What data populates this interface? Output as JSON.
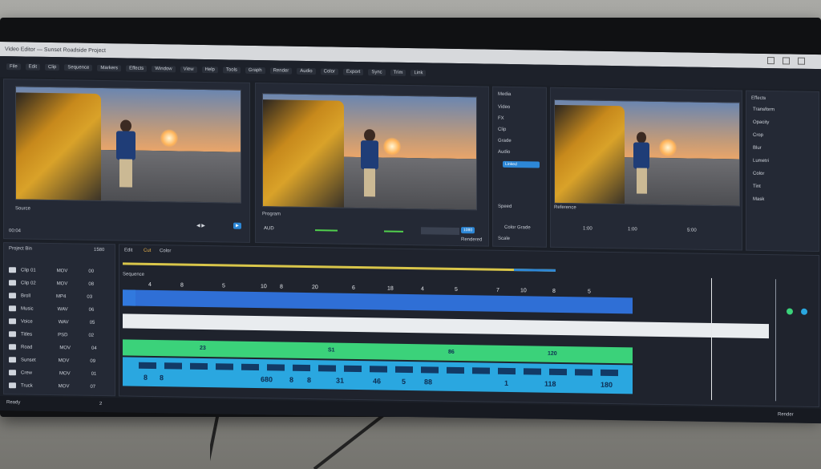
{
  "window": {
    "title": "Video Editor — Sunset Roadside Project"
  },
  "menu": [
    "File",
    "Edit",
    "Clip",
    "Sequence",
    "Markers",
    "Effects",
    "Window",
    "View",
    "Help",
    "Tools",
    "Graph",
    "Render",
    "Audio",
    "Color",
    "Export",
    "Sync",
    "Trim",
    "Link"
  ],
  "monitors": {
    "source": {
      "label": "Source",
      "timecode": "00:04"
    },
    "program": {
      "label": "Program",
      "audio": "AUD",
      "timecode": "1080",
      "right": "Rendered"
    },
    "reference": {
      "label": "Reference",
      "meta": "Color Grade",
      "tc1": "1:00",
      "tc2": "1:00",
      "tc3": "5:00"
    }
  },
  "inspector": {
    "title": "Media",
    "items": [
      "Video",
      "FX",
      "Clip",
      "Grade",
      "Audio"
    ],
    "active": "Linked",
    "footer": "Speed",
    "footer2": "Scale"
  },
  "effects_panel": {
    "title": "Effects",
    "items": [
      "Transform",
      "Opacity",
      "Crop",
      "Blur",
      "Lumetri",
      "Color",
      "Tint",
      "Mask"
    ]
  },
  "bins": {
    "title": "Project Bin",
    "count": "1580",
    "rows": [
      {
        "name": "Clip 01",
        "kind": "MOV",
        "val": "00"
      },
      {
        "name": "Clip 02",
        "kind": "MOV",
        "val": "08"
      },
      {
        "name": "Broll",
        "kind": "MP4",
        "val": "03"
      },
      {
        "name": "Music",
        "kind": "WAV",
        "val": "06"
      },
      {
        "name": "Voice",
        "kind": "WAV",
        "val": "05"
      },
      {
        "name": "Titles",
        "kind": "PSD",
        "val": "02"
      },
      {
        "name": "Road",
        "kind": "MOV",
        "val": "04"
      },
      {
        "name": "Sunset",
        "kind": "MOV",
        "val": "09"
      },
      {
        "name": "Crew",
        "kind": "MOV",
        "val": "01"
      },
      {
        "name": "Truck",
        "kind": "MOV",
        "val": "07"
      }
    ]
  },
  "timeline": {
    "tabs": [
      "Edit",
      "Cut",
      "Color"
    ],
    "track_label": "Sequence",
    "ruler": [
      "4",
      "8",
      "5",
      "10",
      "8",
      "20",
      "6",
      "18",
      "4",
      "5",
      "7",
      "10",
      "8",
      "5"
    ],
    "green_labels": [
      "23",
      "S1",
      "86",
      "120"
    ],
    "blue_numbers": [
      "680",
      "8",
      "8",
      "8",
      "8",
      "31",
      "46",
      "5",
      "88",
      "1",
      "118",
      "180"
    ]
  },
  "statusbar": {
    "left": "Ready",
    "zoom": "2",
    "right": "Render"
  },
  "colors": {
    "accent": "#2d87d6",
    "video_track": "#2f6fd6",
    "audio_green": "#3bd27a",
    "audio_blue": "#2aa7e0"
  }
}
